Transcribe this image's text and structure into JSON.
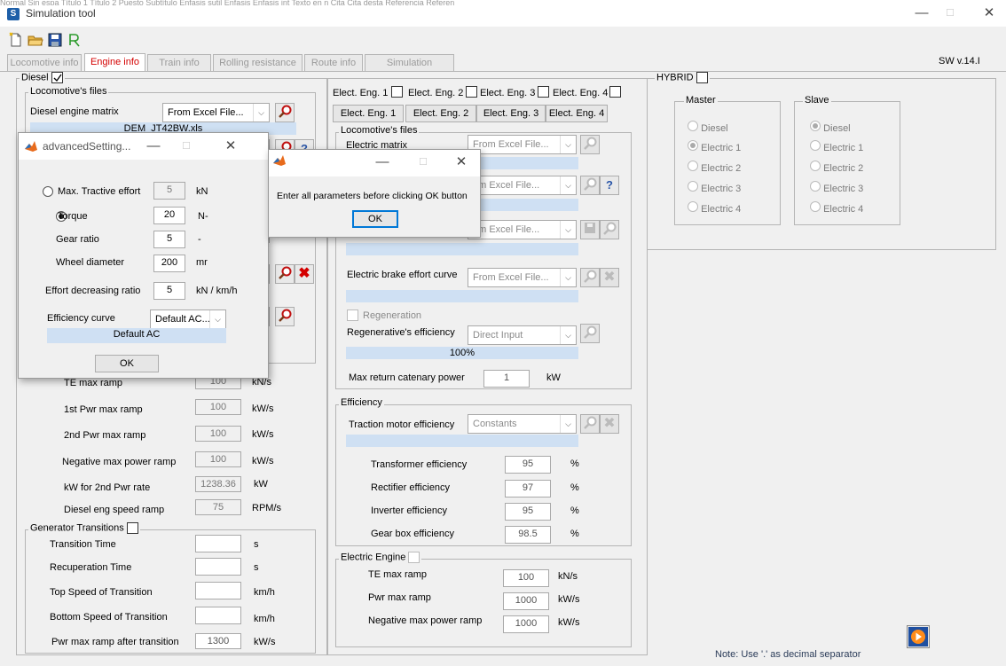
{
  "window": {
    "title": "Simulation tool",
    "top_strip": "Normal   Sin espa   Título 1   Título 2   Puesto   Subtítulo   Énfasis sutil   Énfasis   Énfasis int   Texto en n   Cita   Cita desta   Referencia   Referen",
    "minimize": "—",
    "maximize": "☐",
    "close": "✕"
  },
  "toolbar": {
    "icons": [
      "new-file-icon",
      "open-folder-icon",
      "save-disk-icon",
      "run-script-icon"
    ]
  },
  "tabs": [
    {
      "label": "Locomotive info",
      "active": false
    },
    {
      "label": "Engine info",
      "active": true
    },
    {
      "label": "Train info",
      "active": false
    },
    {
      "label": "Rolling resistance",
      "active": false
    },
    {
      "label": "Route info",
      "active": false
    },
    {
      "label": "Simulation",
      "active": false
    }
  ],
  "sw_version": "SW v.14.I",
  "diesel": {
    "label": "Diesel",
    "checked": true,
    "files_label": "Locomotive's files",
    "engine_matrix_label": "Diesel engine matrix",
    "engine_matrix_value": "From Excel File...",
    "engine_matrix_file": "DEM_JT42BW.xls",
    "ramps": [
      {
        "label": "TE max ramp",
        "value": "100",
        "unit": "kN/s"
      },
      {
        "label": "1st Pwr max ramp",
        "value": "100",
        "unit": "kW/s"
      },
      {
        "label": "2nd Pwr max ramp",
        "value": "100",
        "unit": "kW/s"
      },
      {
        "label": "Negative max power ramp",
        "value": "100",
        "unit": "kW/s"
      },
      {
        "label": "kW for 2nd Pwr rate",
        "value": "1238.36",
        "unit": "kW"
      },
      {
        "label": "Diesel eng speed ramp",
        "value": "75",
        "unit": "RPM/s"
      }
    ]
  },
  "generator": {
    "label": "Generator Transitions",
    "rows": [
      {
        "label": "Transition Time",
        "value": "",
        "unit": "s"
      },
      {
        "label": "Recuperation Time",
        "value": "",
        "unit": "s"
      },
      {
        "label": "Top Speed of Transition",
        "value": "",
        "unit": "km/h"
      },
      {
        "label": "Bottom Speed of Transition",
        "value": "",
        "unit": "km/h"
      },
      {
        "label": "Pwr max ramp after transition",
        "value": "1300",
        "unit": "kW/s"
      }
    ]
  },
  "electric": {
    "engine_checks": [
      "Elect. Eng. 1",
      "Elect. Eng. 2",
      "Elect. Eng. 3",
      "Elect. Eng. 4"
    ],
    "engine_tabs": [
      "Elect. Eng. 1",
      "Elect. Eng. 2",
      "Elect. Eng. 3",
      "Elect. Eng. 4"
    ],
    "files_label": "Locomotive's files",
    "matrix_label": "Electric  matrix",
    "dropdown_value": "From Excel File...",
    "dropdown_partial": "om Excel File...",
    "brake_label": "Electric brake effort curve",
    "regeneration_label": "Regeneration",
    "regen_eff_label": "Regenerative's  efficiency",
    "regen_eff_value": "Direct Input",
    "regen_eff_display": "100%",
    "max_return_label": "Max return catenary power",
    "max_return_value": "1",
    "max_return_unit": "kW"
  },
  "efficiency": {
    "label": "Efficiency",
    "motor_label": "Traction motor efficiency",
    "motor_value": "Constants",
    "rows": [
      {
        "label": "Transformer efficiency",
        "value": "95",
        "unit": "%"
      },
      {
        "label": "Rectifier efficiency",
        "value": "97",
        "unit": "%"
      },
      {
        "label": "Inverter efficiency",
        "value": "95",
        "unit": "%"
      },
      {
        "label": "Gear box efficiency",
        "value": "98.5",
        "unit": "%"
      }
    ]
  },
  "electric_engine": {
    "label": "Electric Engine",
    "rows": [
      {
        "label": "TE max ramp",
        "value": "100",
        "unit": "kN/s"
      },
      {
        "label": "Pwr max ramp",
        "value": "1000",
        "unit": "kW/s"
      },
      {
        "label": "Negative max power ramp",
        "value": "1000",
        "unit": "kW/s"
      }
    ]
  },
  "hybrid": {
    "label": "HYBRID",
    "master_label": "Master",
    "slave_label": "Slave",
    "options": [
      "Diesel",
      "Electric 1",
      "Electric 2",
      "Electric 3",
      "Electric 4"
    ],
    "master_selected": "Electric 1",
    "slave_selected": "Diesel"
  },
  "note": "Note: Use '.' as decimal separator",
  "advanced_dialog": {
    "title": "advancedSetting...",
    "max_te_label": "Max. Tractive effort",
    "max_te_value": "5",
    "max_te_unit": "kN",
    "torque_label": "Torque",
    "torque_value": "20",
    "torque_unit": "N-",
    "gear_label": "Gear ratio",
    "gear_value": "5",
    "gear_unit": "-",
    "wheel_label": "Wheel diameter",
    "wheel_value": "200",
    "wheel_unit": "mr",
    "decrease_label": "Effort decreasing ratio",
    "decrease_value": "5",
    "decrease_unit": "kN / km/h",
    "curve_label": "Efficiency curve",
    "curve_value": "Default AC...",
    "curve_display": "Default AC",
    "ok": "OK",
    "selected": "Torque"
  },
  "error_dialog": {
    "message": "Enter all parameters before clicking OK button",
    "ok": "OK"
  },
  "colors": {
    "accent_red": "#d40000",
    "info_bar": "#cfe0f3",
    "dialog_focus": "#0078d7"
  }
}
